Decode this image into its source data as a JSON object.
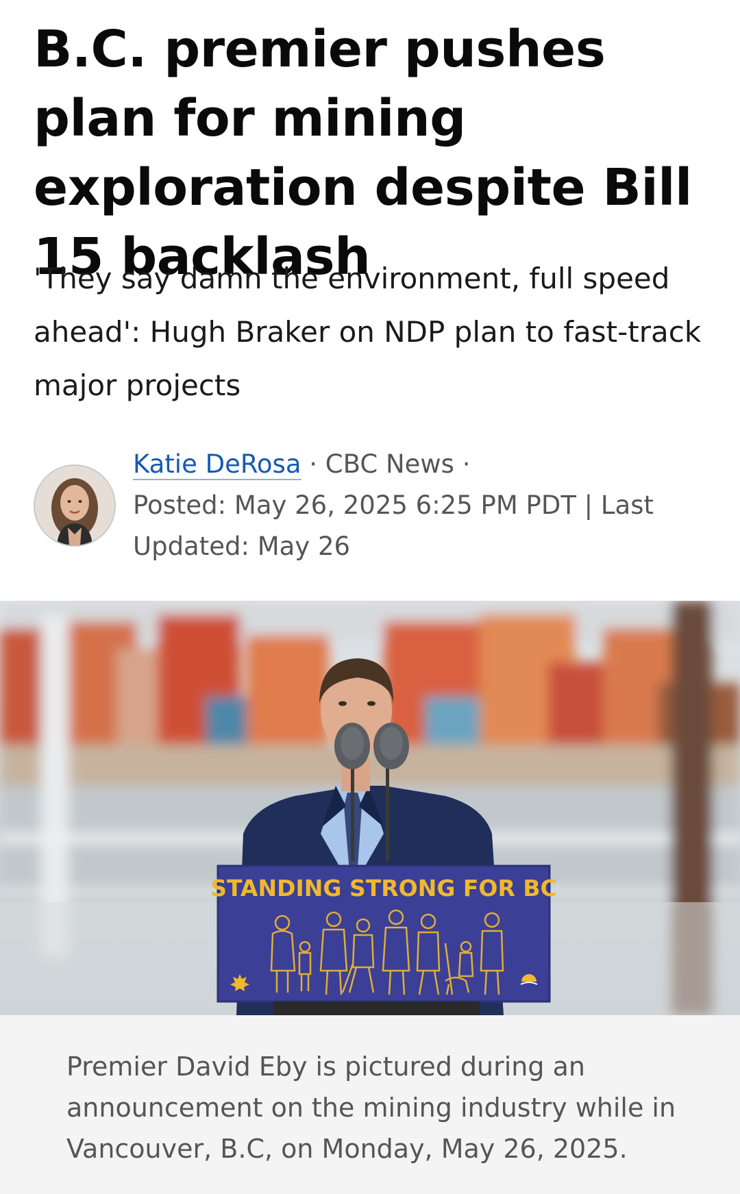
{
  "article": {
    "headline": "B.C. premier pushes plan for mining exploration despite Bill 15 backlash",
    "deck": "'They say damn the environment, full speed ahead': Hugh Braker on NDP plan to fast-track major projects",
    "byline": {
      "author": "Katie DeRosa",
      "separator": "·",
      "outlet": "CBC News",
      "posted": "Posted: May 26, 2025 6:25 PM PDT | Last Updated: May 26"
    },
    "photo": {
      "podium_sign": "STANDING STRONG FOR BC",
      "colors": {
        "sign_blue": "#3b3f95",
        "sign_text": "#f1b82d",
        "suit": "#1f2f5a"
      }
    },
    "caption": "Premier David Eby is pictured during an announcement on the mining industry while in Vancouver, B.C, on Monday, May 26, 2025."
  },
  "colors": {
    "link": "#1559b3",
    "meta_text": "#555555",
    "caption_bg": "#f4f4f4"
  }
}
